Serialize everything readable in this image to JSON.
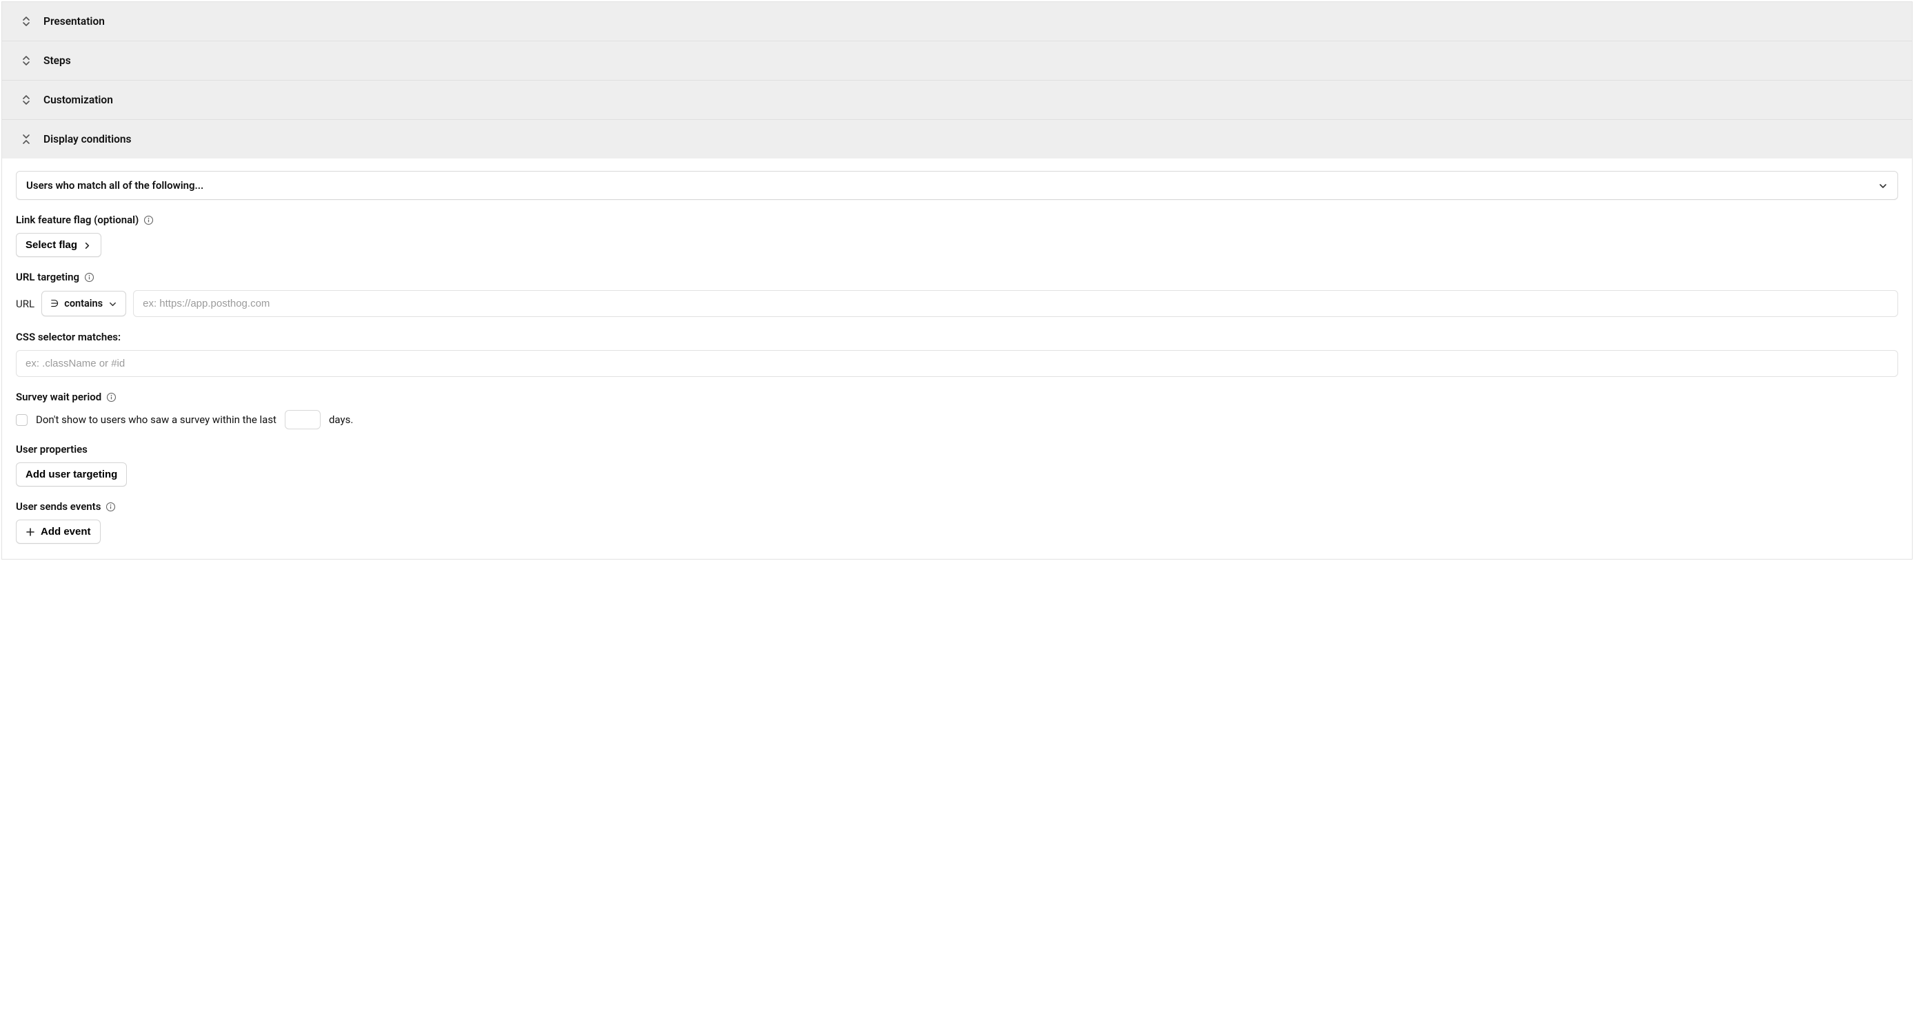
{
  "accordion": {
    "presentation": "Presentation",
    "steps": "Steps",
    "customization": "Customization",
    "display_conditions": "Display conditions"
  },
  "display": {
    "match_dropdown": "Users who match all of the following...",
    "feature_flag_label": "Link feature flag (optional)",
    "select_flag_btn": "Select flag",
    "url_targeting_label": "URL targeting",
    "url_field_label": "URL",
    "url_match_op": "contains",
    "url_match_sym": "∋",
    "url_placeholder": "ex: https://app.posthog.com",
    "css_selector_label": "CSS selector matches:",
    "css_selector_placeholder": "ex: .className or #id",
    "wait_period_label": "Survey wait period",
    "wait_period_pre": "Don't show to users who saw a survey within the last",
    "wait_period_post": "days.",
    "user_properties_label": "User properties",
    "add_user_targeting_btn": "Add user targeting",
    "user_sends_events_label": "User sends events",
    "add_event_btn": "Add event"
  }
}
